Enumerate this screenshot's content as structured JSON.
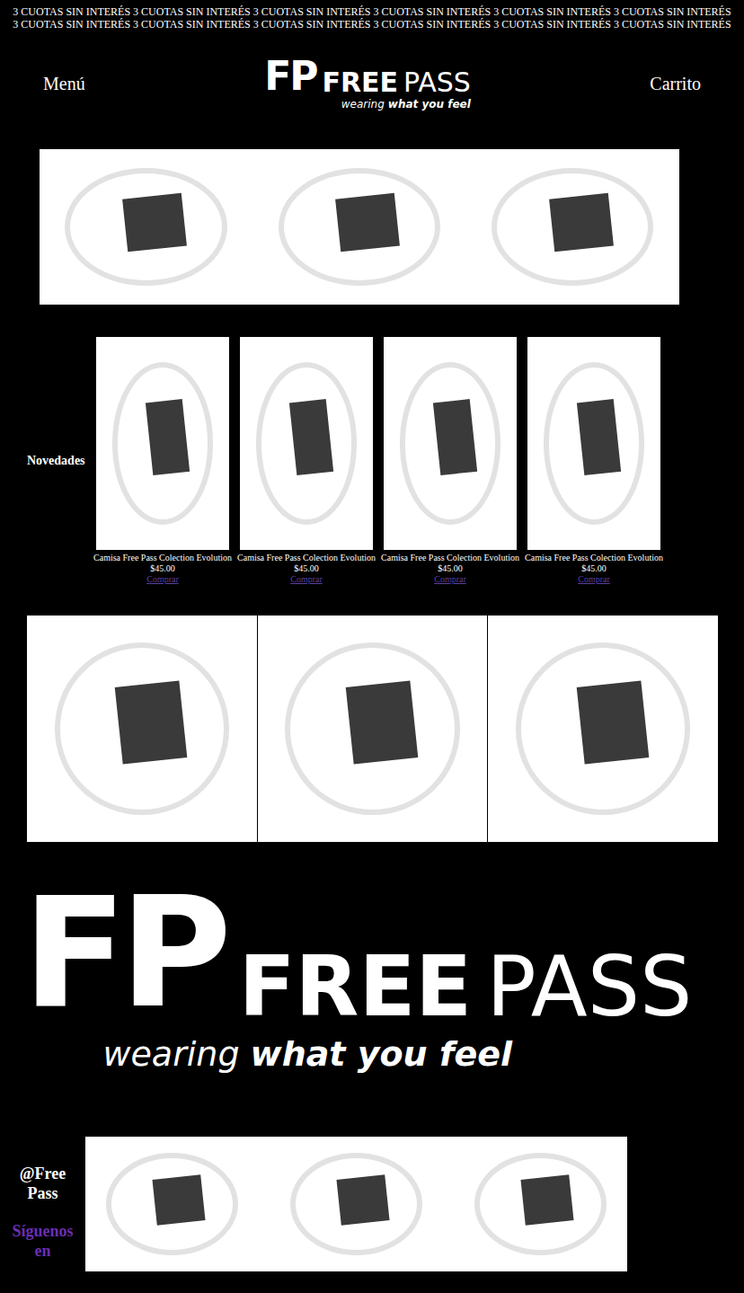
{
  "announcement": "3 CUOTAS SIN INTERÉS 3 CUOTAS SIN INTERÉS 3 CUOTAS SIN INTERÉS 3 CUOTAS SIN INTERÉS 3 CUOTAS SIN INTERÉS 3 CUOTAS SIN INTERÉS 3 CUOTAS SIN INTERÉS 3 CUOTAS SIN INTERÉS 3 CUOTAS SIN INTERÉS 3 CUOTAS SIN INTERÉS 3 CUOTAS SIN INTERÉS 3 CUOTAS SIN INTERÉS",
  "header": {
    "menu": "Menú",
    "cart": "Carrito"
  },
  "logo": {
    "mark": "FP",
    "name": [
      "FREE",
      "PASS"
    ],
    "tagline": [
      "wearing",
      "what you feel"
    ]
  },
  "novedades": {
    "title": "Novedades",
    "products": [
      {
        "name": "Camisa Free Pass Colection Evolution",
        "price": "$45.00",
        "action": "Comprar"
      },
      {
        "name": "Camisa Free Pass Colection Evolution",
        "price": "$45.00",
        "action": "Comprar"
      },
      {
        "name": "Camisa Free Pass Colection Evolution",
        "price": "$45.00",
        "action": "Comprar"
      },
      {
        "name": "Camisa Free Pass Colection Evolution",
        "price": "$45.00",
        "action": "Comprar"
      }
    ]
  },
  "footer": {
    "handle": "@Free Pass",
    "follow": "Síguenos en"
  }
}
